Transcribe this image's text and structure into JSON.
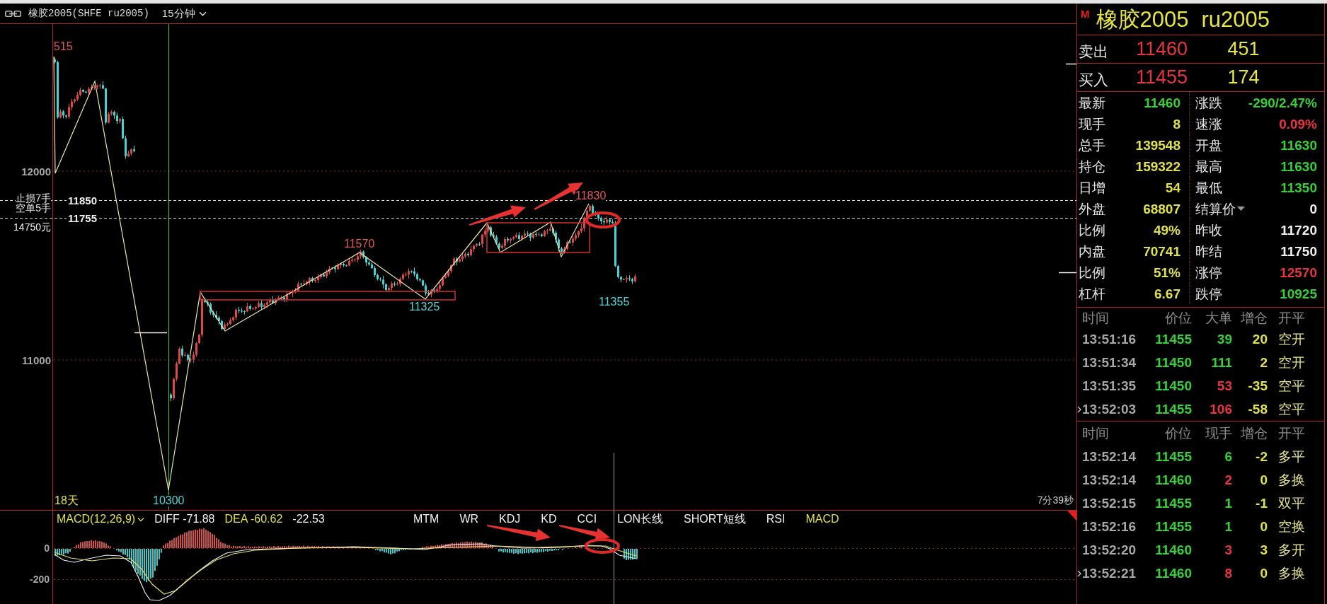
{
  "window": {
    "title": "橡胶2005(SHFE ru2005)",
    "period": "15分钟"
  },
  "price_chart": {
    "price_ticks": [
      "12000",
      "11000"
    ],
    "order_lines": [
      {
        "label": "止损7手",
        "price": "11850"
      },
      {
        "label": "空单5手",
        "price": "11755"
      }
    ],
    "order_amount": "14750元",
    "swing_labels": [
      {
        "text": "515",
        "kind": "high"
      },
      {
        "text": "11570",
        "kind": "high"
      },
      {
        "text": "11325",
        "kind": "low"
      },
      {
        "text": "11830",
        "kind": "high"
      },
      {
        "text": "11355",
        "kind": "low"
      },
      {
        "text": "10300",
        "kind": "low"
      }
    ],
    "period_count": "18天",
    "countdown": "7分39秒"
  },
  "indicator": {
    "name": "MACD(12,26,9)",
    "readouts": [
      {
        "text": "DIFF -71.88",
        "kind": "diff"
      },
      {
        "text": "DEA -60.62",
        "kind": "dea"
      },
      {
        "text": "-22.53",
        "kind": "macd"
      }
    ],
    "tabs": [
      {
        "label": "MTM",
        "selected": false
      },
      {
        "label": "WR",
        "selected": false
      },
      {
        "label": "KDJ",
        "selected": false
      },
      {
        "label": "KD",
        "selected": false
      },
      {
        "label": "CCI",
        "selected": false
      },
      {
        "label": "LON长线",
        "selected": false
      },
      {
        "label": "SHORT短线",
        "selected": false
      },
      {
        "label": "RSI",
        "selected": false
      },
      {
        "label": "MACD",
        "selected": true
      }
    ],
    "axis_labels": [
      "0",
      "-200"
    ]
  },
  "quote": {
    "badge": "M",
    "name": "橡胶2005",
    "code": "ru2005",
    "ask": {
      "label": "卖出",
      "price": "11460",
      "volume": "451"
    },
    "bid": {
      "label": "买入",
      "price": "11455",
      "volume": "174"
    },
    "stats": [
      {
        "label": "最新",
        "value": "11460",
        "color": "#35d035",
        "dropdown": false
      },
      {
        "label": "涨跌",
        "value": "-290/2.47%",
        "color": "#35d035",
        "dropdown": false
      },
      {
        "label": "现手",
        "value": "8",
        "color": "#e0e04a",
        "dropdown": false
      },
      {
        "label": "速涨",
        "value": "0.09%",
        "color": "#e8353f",
        "dropdown": false
      },
      {
        "label": "总手",
        "value": "139548",
        "color": "#e0e04a",
        "dropdown": false
      },
      {
        "label": "开盘",
        "value": "11630",
        "color": "#35d035",
        "dropdown": false
      },
      {
        "label": "持仓",
        "value": "159322",
        "color": "#e0e04a",
        "dropdown": false
      },
      {
        "label": "最高",
        "value": "11630",
        "color": "#35d035",
        "dropdown": false
      },
      {
        "label": "日增",
        "value": "54",
        "color": "#e0e04a",
        "dropdown": false
      },
      {
        "label": "最低",
        "value": "11350",
        "color": "#35d035",
        "dropdown": false
      },
      {
        "label": "外盘",
        "value": "68807",
        "color": "#e0e04a",
        "dropdown": false
      },
      {
        "label": "结算价",
        "value": "0",
        "color": "#f0f0f0",
        "dropdown": true
      },
      {
        "label": "比例",
        "value": "49%",
        "color": "#e0e04a",
        "dropdown": false
      },
      {
        "label": "昨收",
        "value": "11720",
        "color": "#f0f0f0",
        "dropdown": false
      },
      {
        "label": "内盘",
        "value": "70741",
        "color": "#e0e04a",
        "dropdown": false
      },
      {
        "label": "昨结",
        "value": "11750",
        "color": "#f0f0f0",
        "dropdown": false
      },
      {
        "label": "比例",
        "value": "51%",
        "color": "#e0e04a",
        "dropdown": false
      },
      {
        "label": "涨停",
        "value": "12570",
        "color": "#e8353f",
        "dropdown": false
      },
      {
        "label": "杠杆",
        "value": "6.67",
        "color": "#e0e04a",
        "dropdown": false
      },
      {
        "label": "跌停",
        "value": "10925",
        "color": "#35d035",
        "dropdown": false
      }
    ]
  },
  "big_orders": {
    "columns": [
      "时间",
      "价位",
      "大单",
      "增仓",
      "开平"
    ],
    "rows": [
      {
        "time": "13:51:16",
        "price": "11455",
        "size": "39",
        "change": "20",
        "type": "空开",
        "color": "#35d035",
        "current": false
      },
      {
        "time": "13:51:34",
        "price": "11450",
        "size": "111",
        "change": "2",
        "type": "空开",
        "color": "#35d035",
        "current": false
      },
      {
        "time": "13:51:35",
        "price": "11450",
        "size": "53",
        "change": "-35",
        "type": "空平",
        "color": "#e8353f",
        "current": false
      },
      {
        "time": "13:52:03",
        "price": "11455",
        "size": "106",
        "change": "-58",
        "type": "空平",
        "color": "#e8353f",
        "current": true
      }
    ]
  },
  "ticks": {
    "columns": [
      "时间",
      "价位",
      "现手",
      "增仓",
      "开平"
    ],
    "rows": [
      {
        "time": "13:52:14",
        "price": "11455",
        "size": "6",
        "change": "-2",
        "type": "多平",
        "color": "#35d035",
        "current": false
      },
      {
        "time": "13:52:14",
        "price": "11460",
        "size": "2",
        "change": "0",
        "type": "多换",
        "color": "#e8353f",
        "current": false
      },
      {
        "time": "13:52:15",
        "price": "11455",
        "size": "1",
        "change": "-1",
        "type": "双平",
        "color": "#35d035",
        "current": false
      },
      {
        "time": "13:52:16",
        "price": "11455",
        "size": "1",
        "change": "0",
        "type": "空换",
        "color": "#35d035",
        "current": false
      },
      {
        "time": "13:52:20",
        "price": "11460",
        "size": "3",
        "change": "3",
        "type": "多开",
        "color": "#e8353f",
        "current": false
      },
      {
        "time": "13:52:21",
        "price": "11460",
        "size": "8",
        "change": "0",
        "type": "多换",
        "color": "#e8353f",
        "current": true
      }
    ]
  }
}
